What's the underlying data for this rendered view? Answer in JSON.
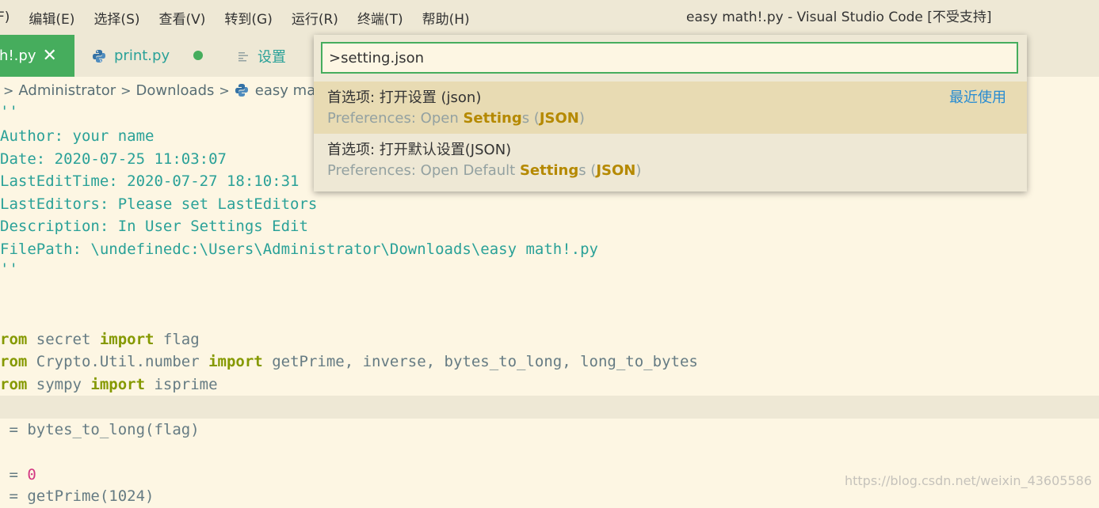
{
  "titlebar": {
    "menu": [
      "F)",
      "编辑(E)",
      "选择(S)",
      "查看(V)",
      "转到(G)",
      "运行(R)",
      "终端(T)",
      "帮助(H)"
    ],
    "window_title": "easy math!.py - Visual Studio Code [不受支持]"
  },
  "tabs": {
    "active_label": "th!.py",
    "close_glyph": "✕",
    "print_label": "print.py",
    "settings_label": "设置"
  },
  "breadcrumb": {
    "sep": ">",
    "items": [
      "Administrator",
      "Downloads",
      "easy math"
    ]
  },
  "editor": {
    "doc_open": "''",
    "doc_author": "Author: your name",
    "doc_date": "Date: 2020-07-25 11:03:07",
    "doc_lastedit": "LastEditTime: 2020-07-27 18:10:31",
    "doc_editors": "LastEditors: Please set LastEditors",
    "doc_desc": "Description: In User Settings Edit",
    "doc_path": "FilePath: \\undefinedc:\\Users\\Administrator\\Downloads\\easy math!.py",
    "doc_close": "''",
    "l1_from": "rom",
    "l1_mod": " secret ",
    "l1_import": "import",
    "l1_name": " flag",
    "l2_from": "rom",
    "l2_mod": " Crypto.Util.number ",
    "l2_import": "import",
    "l2_names": " getPrime, inverse, bytes_to_long, long_to_bytes",
    "l3_from": "rom",
    "l3_mod": " sympy ",
    "l3_import": "import",
    "l3_name": " isprime",
    "l4_code": " = bytes_to_long(flag)",
    "l5_eq": " = ",
    "l5_num": "0",
    "l6_code": " = getPrime(1024)"
  },
  "palette": {
    "input_value": ">setting.json",
    "results": [
      {
        "label": "首选项: 打开设置 (json)",
        "badge": "最近使用",
        "desc_pre": "Preferences: Open ",
        "desc_hl1": "Setting",
        "desc_mid": "s (",
        "desc_hl2": "JSON",
        "desc_post": ")"
      },
      {
        "label": "首选项: 打开默认设置(JSON)",
        "desc_pre": "Preferences: Open Default ",
        "desc_hl1": "Setting",
        "desc_mid": "s (",
        "desc_hl2": "JSON",
        "desc_post": ")"
      }
    ]
  },
  "watermark": "https://blog.csdn.net/weixin_43605586",
  "colors": {
    "accent_green": "#46AD5D",
    "background": "#FDF6E3",
    "chrome": "#EEE8D5",
    "selection": "#E8DBB3",
    "highlight": "#B58900",
    "link_blue": "#268BD2",
    "comment_teal": "#2AA198"
  }
}
